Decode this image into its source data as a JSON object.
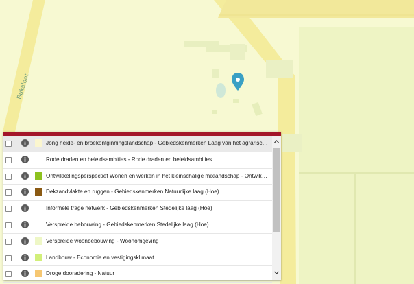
{
  "map": {
    "street_label": "Buksloot",
    "colors": {
      "background": "#f7f9d2",
      "road": "#f4ec9c",
      "field": "#eef4c4",
      "lawn": "#e3efbd",
      "pond": "#cfe8d8",
      "marker": "#3aa0c4"
    },
    "marker_icon": "map-pin-icon"
  },
  "legend": {
    "header_color": "#a3162a",
    "info_icon": "info-icon",
    "items": [
      {
        "label": "Jong heide- en broekontginningslandschap - Gebiedskenmerken Laag van het agrarisch cultuu…",
        "swatch": "#fbf6cf",
        "checked": false
      },
      {
        "label": "Rode draden en beleidsambities - Rode draden en beleidsambities",
        "swatch": "",
        "checked": false
      },
      {
        "label": "Ontwikkelingsperspectief Wonen en werken in het kleinschalige mixlandschap - Ontwikkelingsp…",
        "swatch": "#8ec21f",
        "checked": false
      },
      {
        "label": "Dekzandvlakte en ruggen - Gebiedskenmerken Natuurlijke laag (Hoe)",
        "swatch": "#8b5a13",
        "checked": false
      },
      {
        "label": "Informele trage netwerk - Gebiedskenmerken Stedelijke laag (Hoe)",
        "swatch": "",
        "checked": false
      },
      {
        "label": "Verspreide bebouwing - Gebiedskenmerken Stedelijke laag (Hoe)",
        "swatch": "",
        "checked": false
      },
      {
        "label": "Verspreide woonbebouwing - Woonomgeving",
        "swatch": "#eef7c6",
        "checked": false
      },
      {
        "label": "Landbouw - Economie en vestigingsklimaat",
        "swatch": "#d2ef7a",
        "checked": false
      },
      {
        "label": "Droge dooradering - Natuur",
        "swatch": "#f6c772",
        "checked": false
      }
    ],
    "scroll_up_icon": "chevron-up-icon",
    "scroll_down_icon": "chevron-down-icon"
  }
}
